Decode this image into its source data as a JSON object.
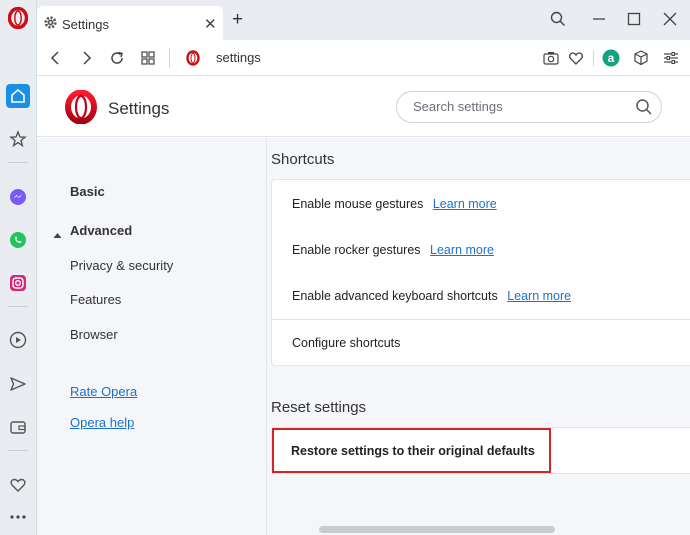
{
  "browser": {
    "tab_title": "Settings",
    "tab_close": "✕",
    "new_tab": "+",
    "url": "settings",
    "accent": "#cc0f16"
  },
  "header": {
    "title": "Settings",
    "search_placeholder": "Search settings"
  },
  "sidebar": {
    "icons": [
      "home-icon",
      "star-icon",
      "messenger-icon",
      "whatsapp-icon",
      "instagram-icon",
      "player-icon",
      "send-icon",
      "wallet-icon",
      "heart-icon",
      "more-icon"
    ]
  },
  "leftnav": {
    "basic": "Basic",
    "advanced": "Advanced",
    "privacy": "Privacy & security",
    "features": "Features",
    "browser": "Browser",
    "rate": "Rate Opera",
    "help": "Opera help"
  },
  "shortcuts": {
    "title": "Shortcuts",
    "mouse_gestures": "Enable mouse gestures",
    "rocker_gestures": "Enable rocker gestures",
    "keyboard_shortcuts": "Enable advanced keyboard shortcuts",
    "learn_more": "Learn more",
    "configure": "Configure shortcuts"
  },
  "reset": {
    "title": "Reset settings",
    "restore": "Restore settings to their original defaults",
    "highlight_color": "#d42424"
  }
}
